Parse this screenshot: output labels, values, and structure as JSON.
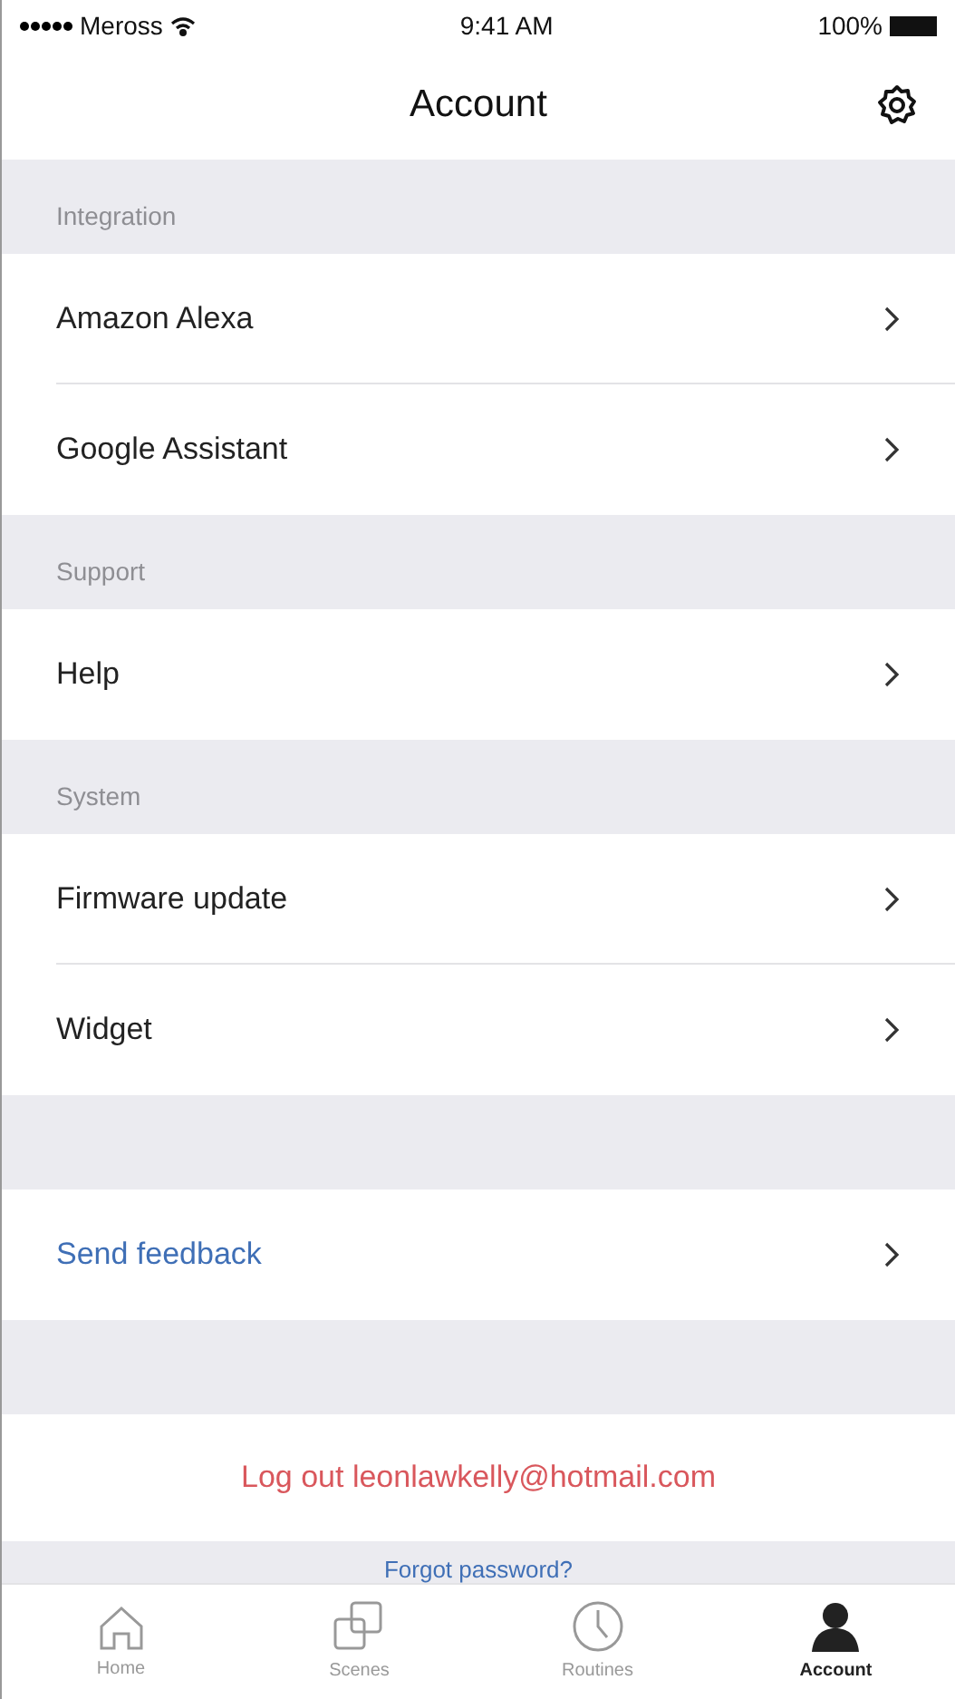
{
  "status_bar": {
    "carrier": "Meross",
    "time": "9:41 AM",
    "battery": "100%"
  },
  "nav": {
    "title": "Account"
  },
  "sections": [
    {
      "header": "Integration",
      "items": [
        {
          "label": "Amazon Alexa",
          "kind": "nav"
        },
        {
          "label": "Google Assistant",
          "kind": "nav"
        }
      ]
    },
    {
      "header": "Support",
      "items": [
        {
          "label": "Help",
          "kind": "nav"
        }
      ]
    },
    {
      "header": "System",
      "items": [
        {
          "label": "Firmware update",
          "kind": "nav"
        },
        {
          "label": "Widget",
          "kind": "nav"
        }
      ]
    },
    {
      "items": [
        {
          "label": "Send feedback",
          "kind": "link"
        }
      ]
    },
    {
      "items": [
        {
          "label": "Log out leonlawkelly@hotmail.com",
          "kind": "danger"
        }
      ]
    }
  ],
  "footer_link": "Forgot password?",
  "tabs": [
    {
      "label": "Home",
      "kind": "home",
      "selected": false
    },
    {
      "label": "Scenes",
      "kind": "scenes",
      "selected": false
    },
    {
      "label": "Routines",
      "kind": "routines",
      "selected": false
    },
    {
      "label": "Account",
      "kind": "account",
      "selected": true
    }
  ]
}
